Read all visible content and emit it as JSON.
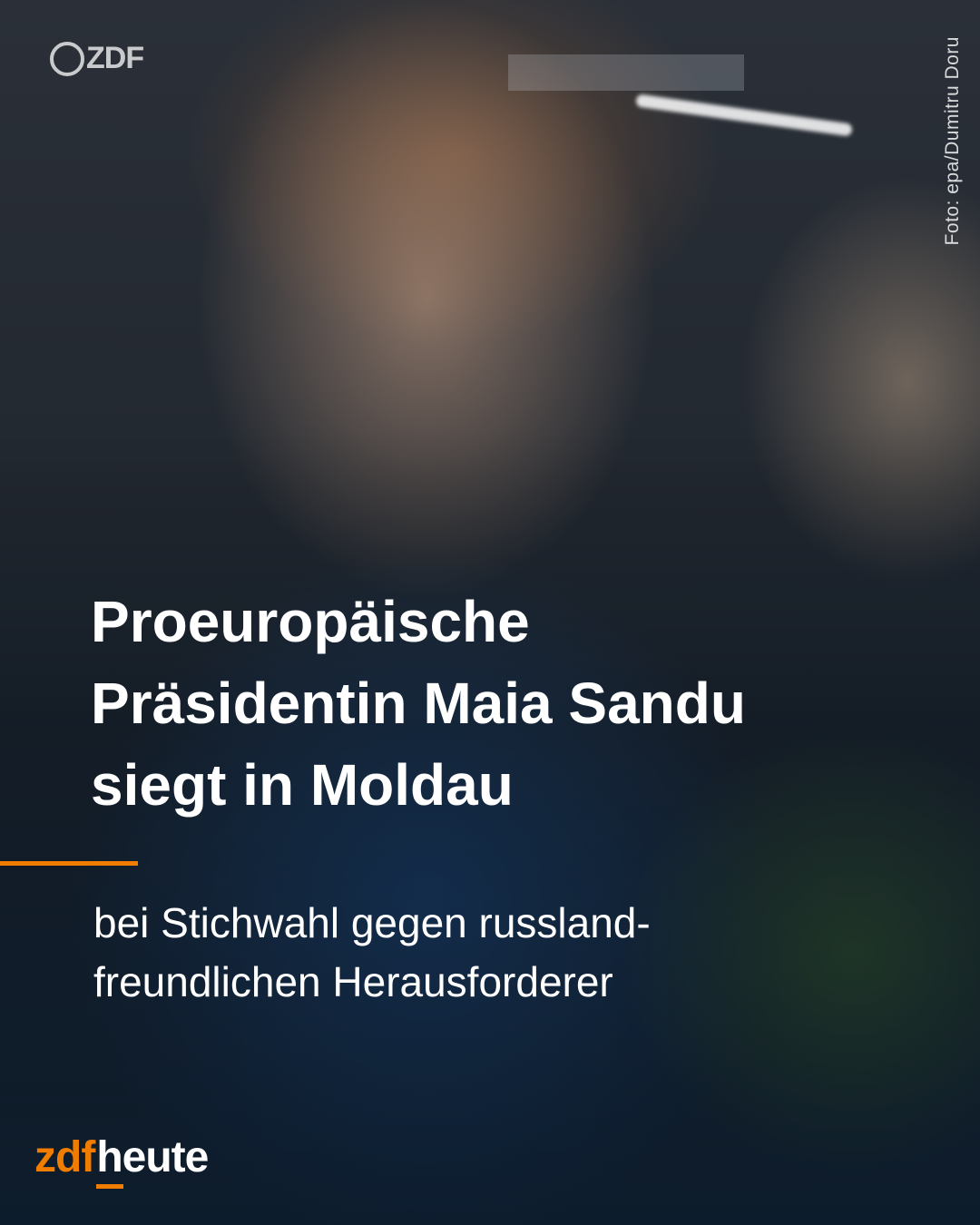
{
  "watermark": {
    "text": "ZDF"
  },
  "photo_credit": "Foto: epa/Dumitru Doru",
  "headline": {
    "line1": "Proeuropäische",
    "line2": "Präsidentin Maia Sandu",
    "line3": "siegt in Moldau"
  },
  "subline": {
    "line1": "bei Stichwahl gegen russland-",
    "line2": "freundlichen Herausforderer"
  },
  "brand": {
    "part1": "zdf",
    "part2": "heute"
  },
  "colors": {
    "accent": "#f07d00",
    "text": "#ffffff"
  }
}
